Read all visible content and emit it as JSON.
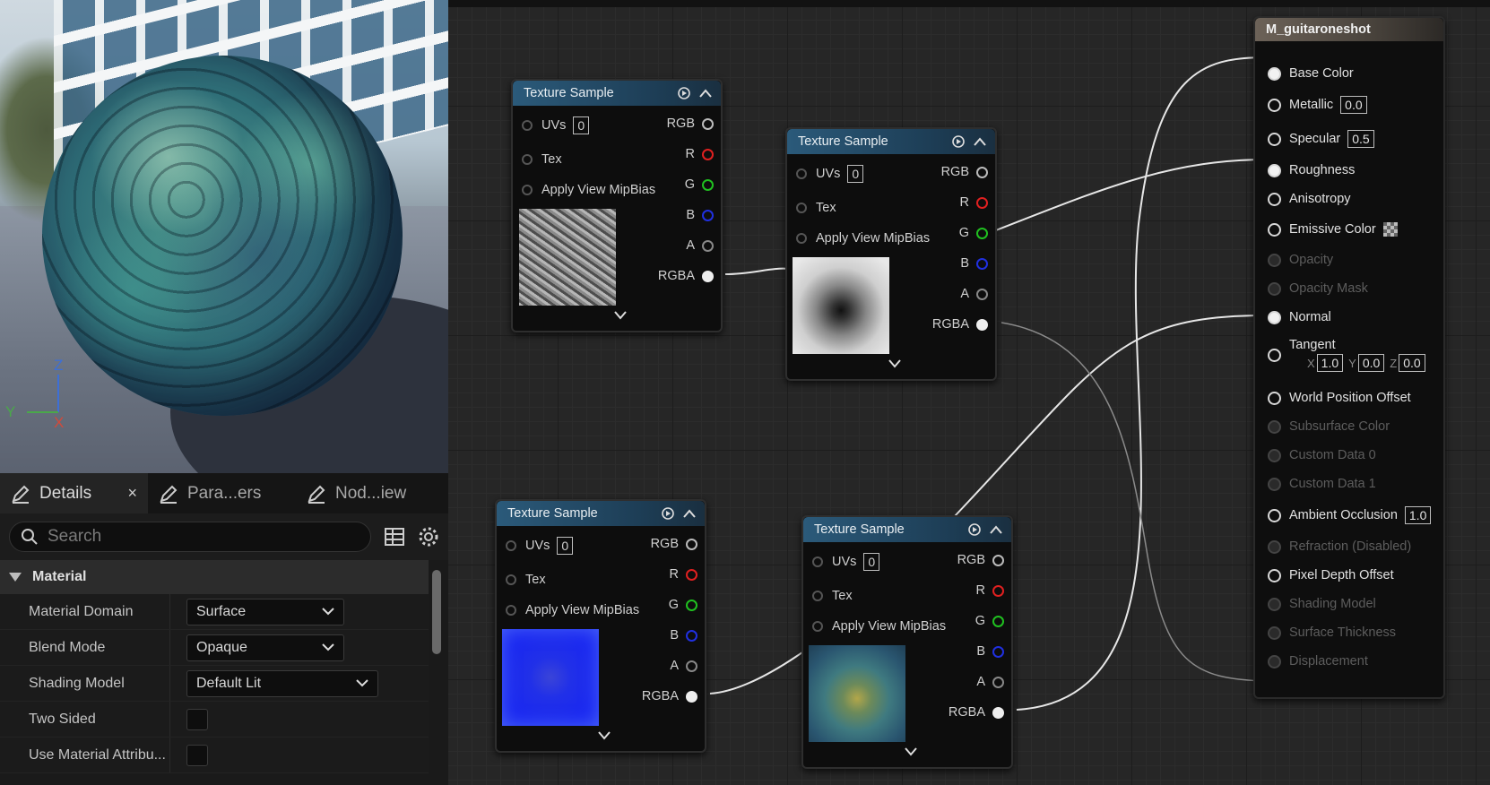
{
  "viewport": {
    "axes": {
      "z": "Z",
      "y": "Y",
      "x": "X"
    }
  },
  "details": {
    "tabs": [
      {
        "label": "Details",
        "close": "×"
      },
      {
        "label": "Para...ers"
      },
      {
        "label": "Nod...iew"
      }
    ],
    "search_placeholder": "Search",
    "category": "Material",
    "properties": [
      {
        "label": "Material Domain",
        "value": "Surface"
      },
      {
        "label": "Blend Mode",
        "value": "Opaque"
      },
      {
        "label": "Shading Model",
        "value": "Default Lit"
      },
      {
        "label": "Two Sided",
        "value": ""
      },
      {
        "label": "Use Material Attribu...",
        "value": ""
      }
    ]
  },
  "nodes": [
    {
      "title": "Texture Sample",
      "uvs": "UVs",
      "uv_value": "0",
      "tex": "Tex",
      "mip": "Apply View MipBias",
      "outputs": [
        "RGB",
        "R",
        "G",
        "B",
        "A",
        "RGBA"
      ],
      "preview": "grayscale-noise"
    },
    {
      "title": "Texture Sample",
      "uvs": "UVs",
      "uv_value": "0",
      "tex": "Tex",
      "mip": "Apply View MipBias",
      "outputs": [
        "RGB",
        "R",
        "G",
        "B",
        "A",
        "RGBA"
      ],
      "preview": "grayscale-blob"
    },
    {
      "title": "Texture Sample",
      "uvs": "UVs",
      "uv_value": "0",
      "tex": "Tex",
      "mip": "Apply View MipBias",
      "outputs": [
        "RGB",
        "R",
        "G",
        "B",
        "A",
        "RGBA"
      ],
      "preview": "normal-map-blue"
    },
    {
      "title": "Texture Sample",
      "uvs": "UVs",
      "uv_value": "0",
      "tex": "Tex",
      "mip": "Apply View MipBias",
      "outputs": [
        "RGB",
        "R",
        "G",
        "B",
        "A",
        "RGBA"
      ],
      "preview": "color-teal"
    }
  ],
  "material": {
    "title": "M_guitaroneshot",
    "inputs": [
      {
        "label": "Base Color",
        "enabled": true,
        "connected": true
      },
      {
        "label": "Metallic",
        "value": "0.0",
        "enabled": true
      },
      {
        "label": "Specular",
        "value": "0.5",
        "enabled": true
      },
      {
        "label": "Roughness",
        "enabled": true,
        "connected": true
      },
      {
        "label": "Anisotropy",
        "enabled": true
      },
      {
        "label": "Emissive Color",
        "enabled": true
      },
      {
        "label": "Opacity",
        "enabled": false
      },
      {
        "label": "Opacity Mask",
        "enabled": false
      },
      {
        "label": "Normal",
        "enabled": true,
        "connected": true
      },
      {
        "label": "Tangent",
        "enabled": true,
        "x": "1.0",
        "y": "0.0",
        "z": "0.0",
        "x_label": "X",
        "y_label": "Y",
        "z_label": "Z"
      },
      {
        "label": "World Position Offset",
        "enabled": true
      },
      {
        "label": "Subsurface Color",
        "enabled": false
      },
      {
        "label": "Custom Data 0",
        "enabled": false
      },
      {
        "label": "Custom Data 1",
        "enabled": false
      },
      {
        "label": "Ambient Occlusion",
        "value": "1.0",
        "enabled": true
      },
      {
        "label": "Refraction (Disabled)",
        "enabled": false
      },
      {
        "label": "Pixel Depth Offset",
        "enabled": true
      },
      {
        "label": "Shading Model",
        "enabled": false
      },
      {
        "label": "Surface Thickness",
        "enabled": false
      },
      {
        "label": "Displacement",
        "enabled": false
      }
    ]
  },
  "colors": {
    "pin_r": "#e02020",
    "pin_g": "#20c020",
    "pin_b": "#2030e0",
    "node_header": "#2b5a7a",
    "material_header": "#6c6258"
  }
}
